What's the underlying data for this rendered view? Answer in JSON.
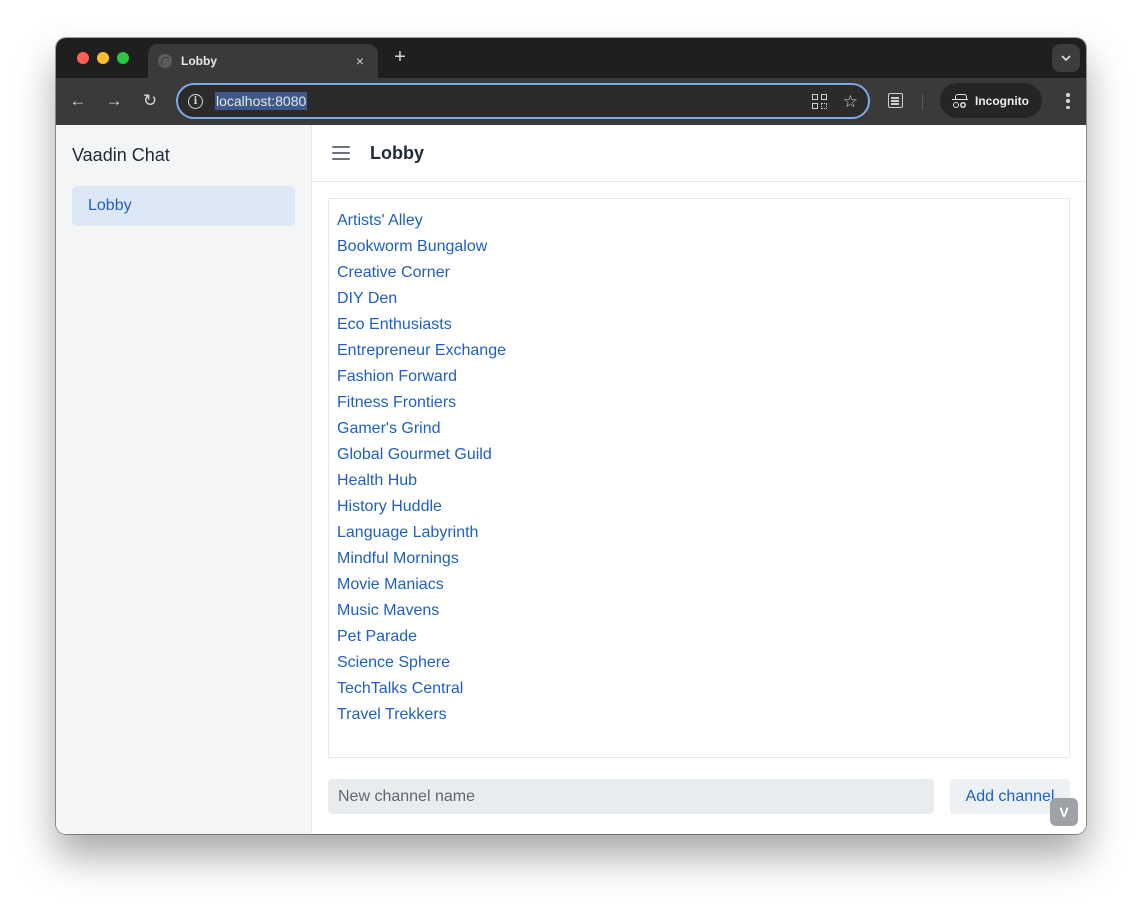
{
  "browser": {
    "tab": {
      "title": "Lobby",
      "close_glyph": "×"
    },
    "new_tab_glyph": "+",
    "tab_search_glyph": "⌄",
    "nav": {
      "back_glyph": "←",
      "forward_glyph": "→",
      "reload_glyph": "↻"
    },
    "url": "localhost:8080",
    "info_glyph": "i",
    "star_glyph": "☆",
    "incognito_label": "Incognito"
  },
  "app": {
    "title": "Vaadin Chat",
    "nav": [
      {
        "label": "Lobby",
        "selected": true
      }
    ]
  },
  "header": {
    "title": "Lobby"
  },
  "channels": [
    "Artists' Alley",
    "Bookworm Bungalow",
    "Creative Corner",
    "DIY Den",
    "Eco Enthusiasts",
    "Entrepreneur Exchange",
    "Fashion Forward",
    "Fitness Frontiers",
    "Gamer's Grind",
    "Global Gourmet Guild",
    "Health Hub",
    "History Huddle",
    "Language Labyrinth",
    "Mindful Mornings",
    "Movie Maniacs",
    "Music Mavens",
    "Pet Parade",
    "Science Sphere",
    "TechTalks Central",
    "Travel Trekkers"
  ],
  "new_channel": {
    "placeholder": "New channel name",
    "value": "",
    "button_label": "Add channel"
  },
  "dev_badge_glyph": "V",
  "colors": {
    "accent": "#1f5fbf",
    "selected_nav_bg": "#dce7f6",
    "sidebar_bg": "#f3f5f7"
  }
}
